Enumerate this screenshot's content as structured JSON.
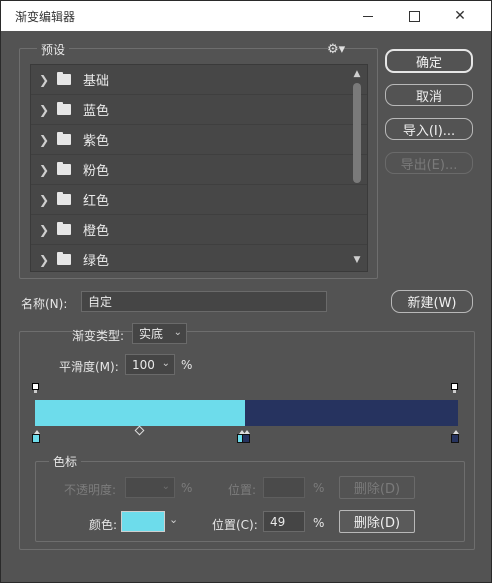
{
  "window": {
    "title": "渐变编辑器"
  },
  "presets": {
    "legend": "预设",
    "gear_icon": "gear-icon",
    "items": [
      {
        "label": "基础"
      },
      {
        "label": "蓝色"
      },
      {
        "label": "紫色"
      },
      {
        "label": "粉色"
      },
      {
        "label": "红色"
      },
      {
        "label": "橙色"
      },
      {
        "label": "绿色"
      }
    ]
  },
  "buttons": {
    "ok": "确定",
    "cancel": "取消",
    "import": "导入(I)...",
    "export": "导出(E)...",
    "new": "新建(W)"
  },
  "name": {
    "label": "名称(N):",
    "value": "自定"
  },
  "gradient": {
    "type_label": "渐变类型:",
    "type_value": "实底",
    "smoothness_label": "平滑度(M):",
    "smoothness_value": "100",
    "smoothness_unit": "%",
    "stops": [
      {
        "color": "#6ddceb",
        "location": 0
      },
      {
        "color": "#6ddceb",
        "location": 49
      },
      {
        "color": "#26335f",
        "location": 49
      },
      {
        "color": "#26335f",
        "location": 100
      }
    ],
    "left_color": "#6ddceb",
    "right_color": "#26335f"
  },
  "color_stop": {
    "legend": "色标",
    "opacity_label": "不透明度:",
    "opacity_unit": "%",
    "opacity_location_label": "位置:",
    "opacity_location_unit": "%",
    "opacity_delete": "删除(D)",
    "color_label": "颜色:",
    "color_swatch": "#6ddceb",
    "color_location_label": "位置(C):",
    "color_location_value": "49",
    "color_location_unit": "%",
    "color_delete": "删除(D)"
  }
}
